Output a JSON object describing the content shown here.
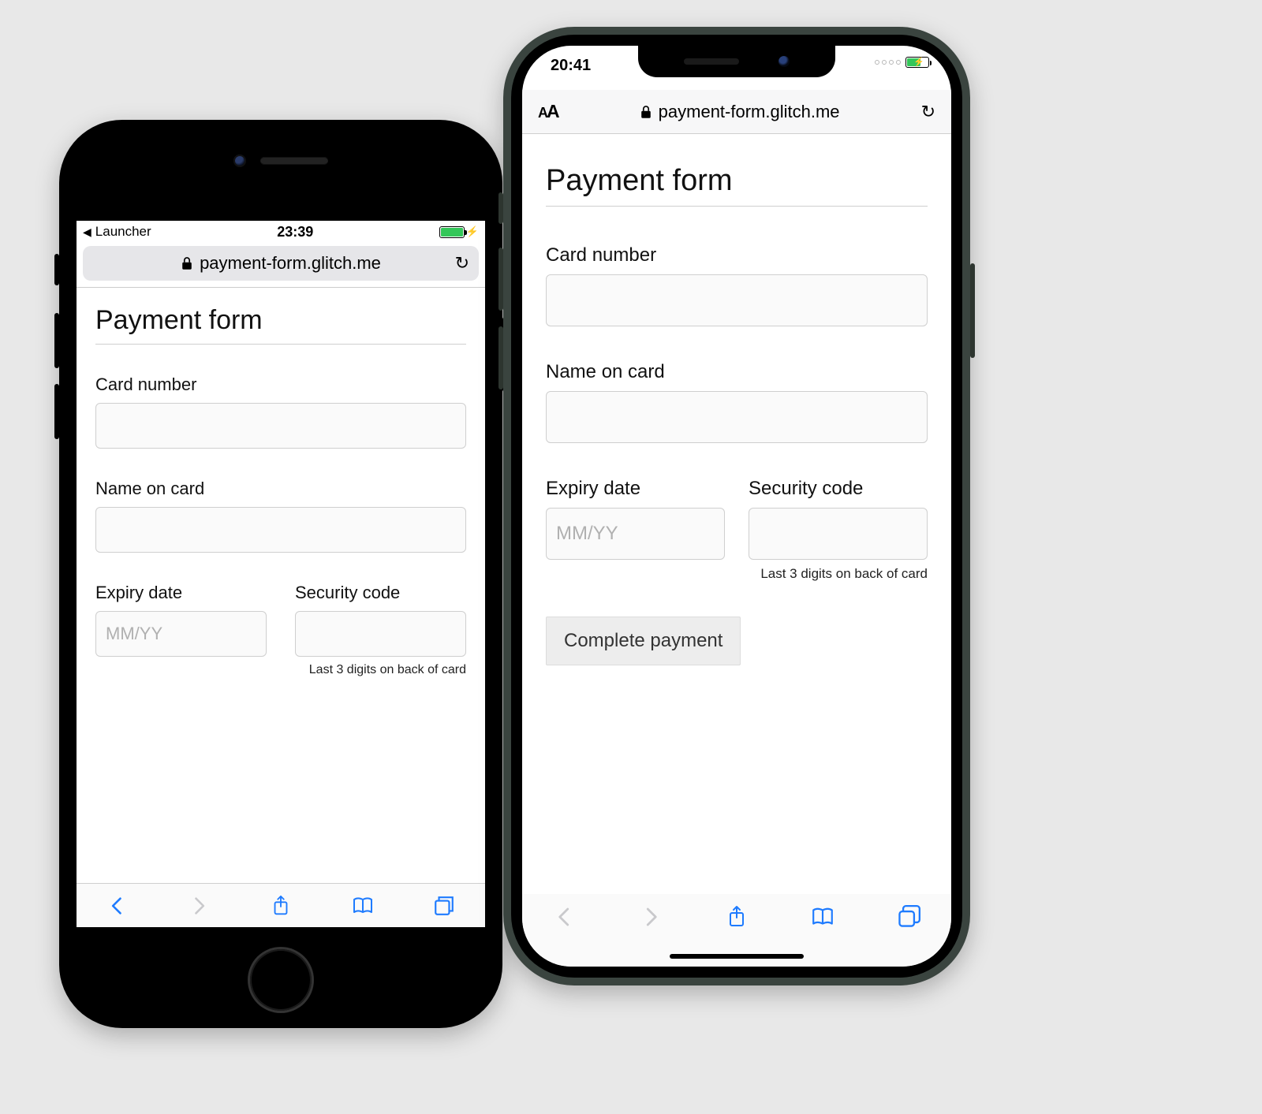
{
  "phone7": {
    "status": {
      "back_app": "Launcher",
      "time": "23:39"
    },
    "url": "payment-form.glitch.me",
    "page": {
      "title": "Payment form",
      "card_number_label": "Card number",
      "name_label": "Name on card",
      "expiry_label": "Expiry date",
      "expiry_placeholder": "MM/YY",
      "cvc_label": "Security code",
      "cvc_hint": "Last 3 digits on back of card"
    }
  },
  "phone11": {
    "status": {
      "time": "20:41"
    },
    "url": "payment-form.glitch.me",
    "page": {
      "title": "Payment form",
      "card_number_label": "Card number",
      "name_label": "Name on card",
      "expiry_label": "Expiry date",
      "expiry_placeholder": "MM/YY",
      "cvc_label": "Security code",
      "cvc_hint": "Last 3 digits on back of card",
      "submit_label": "Complete payment"
    }
  }
}
